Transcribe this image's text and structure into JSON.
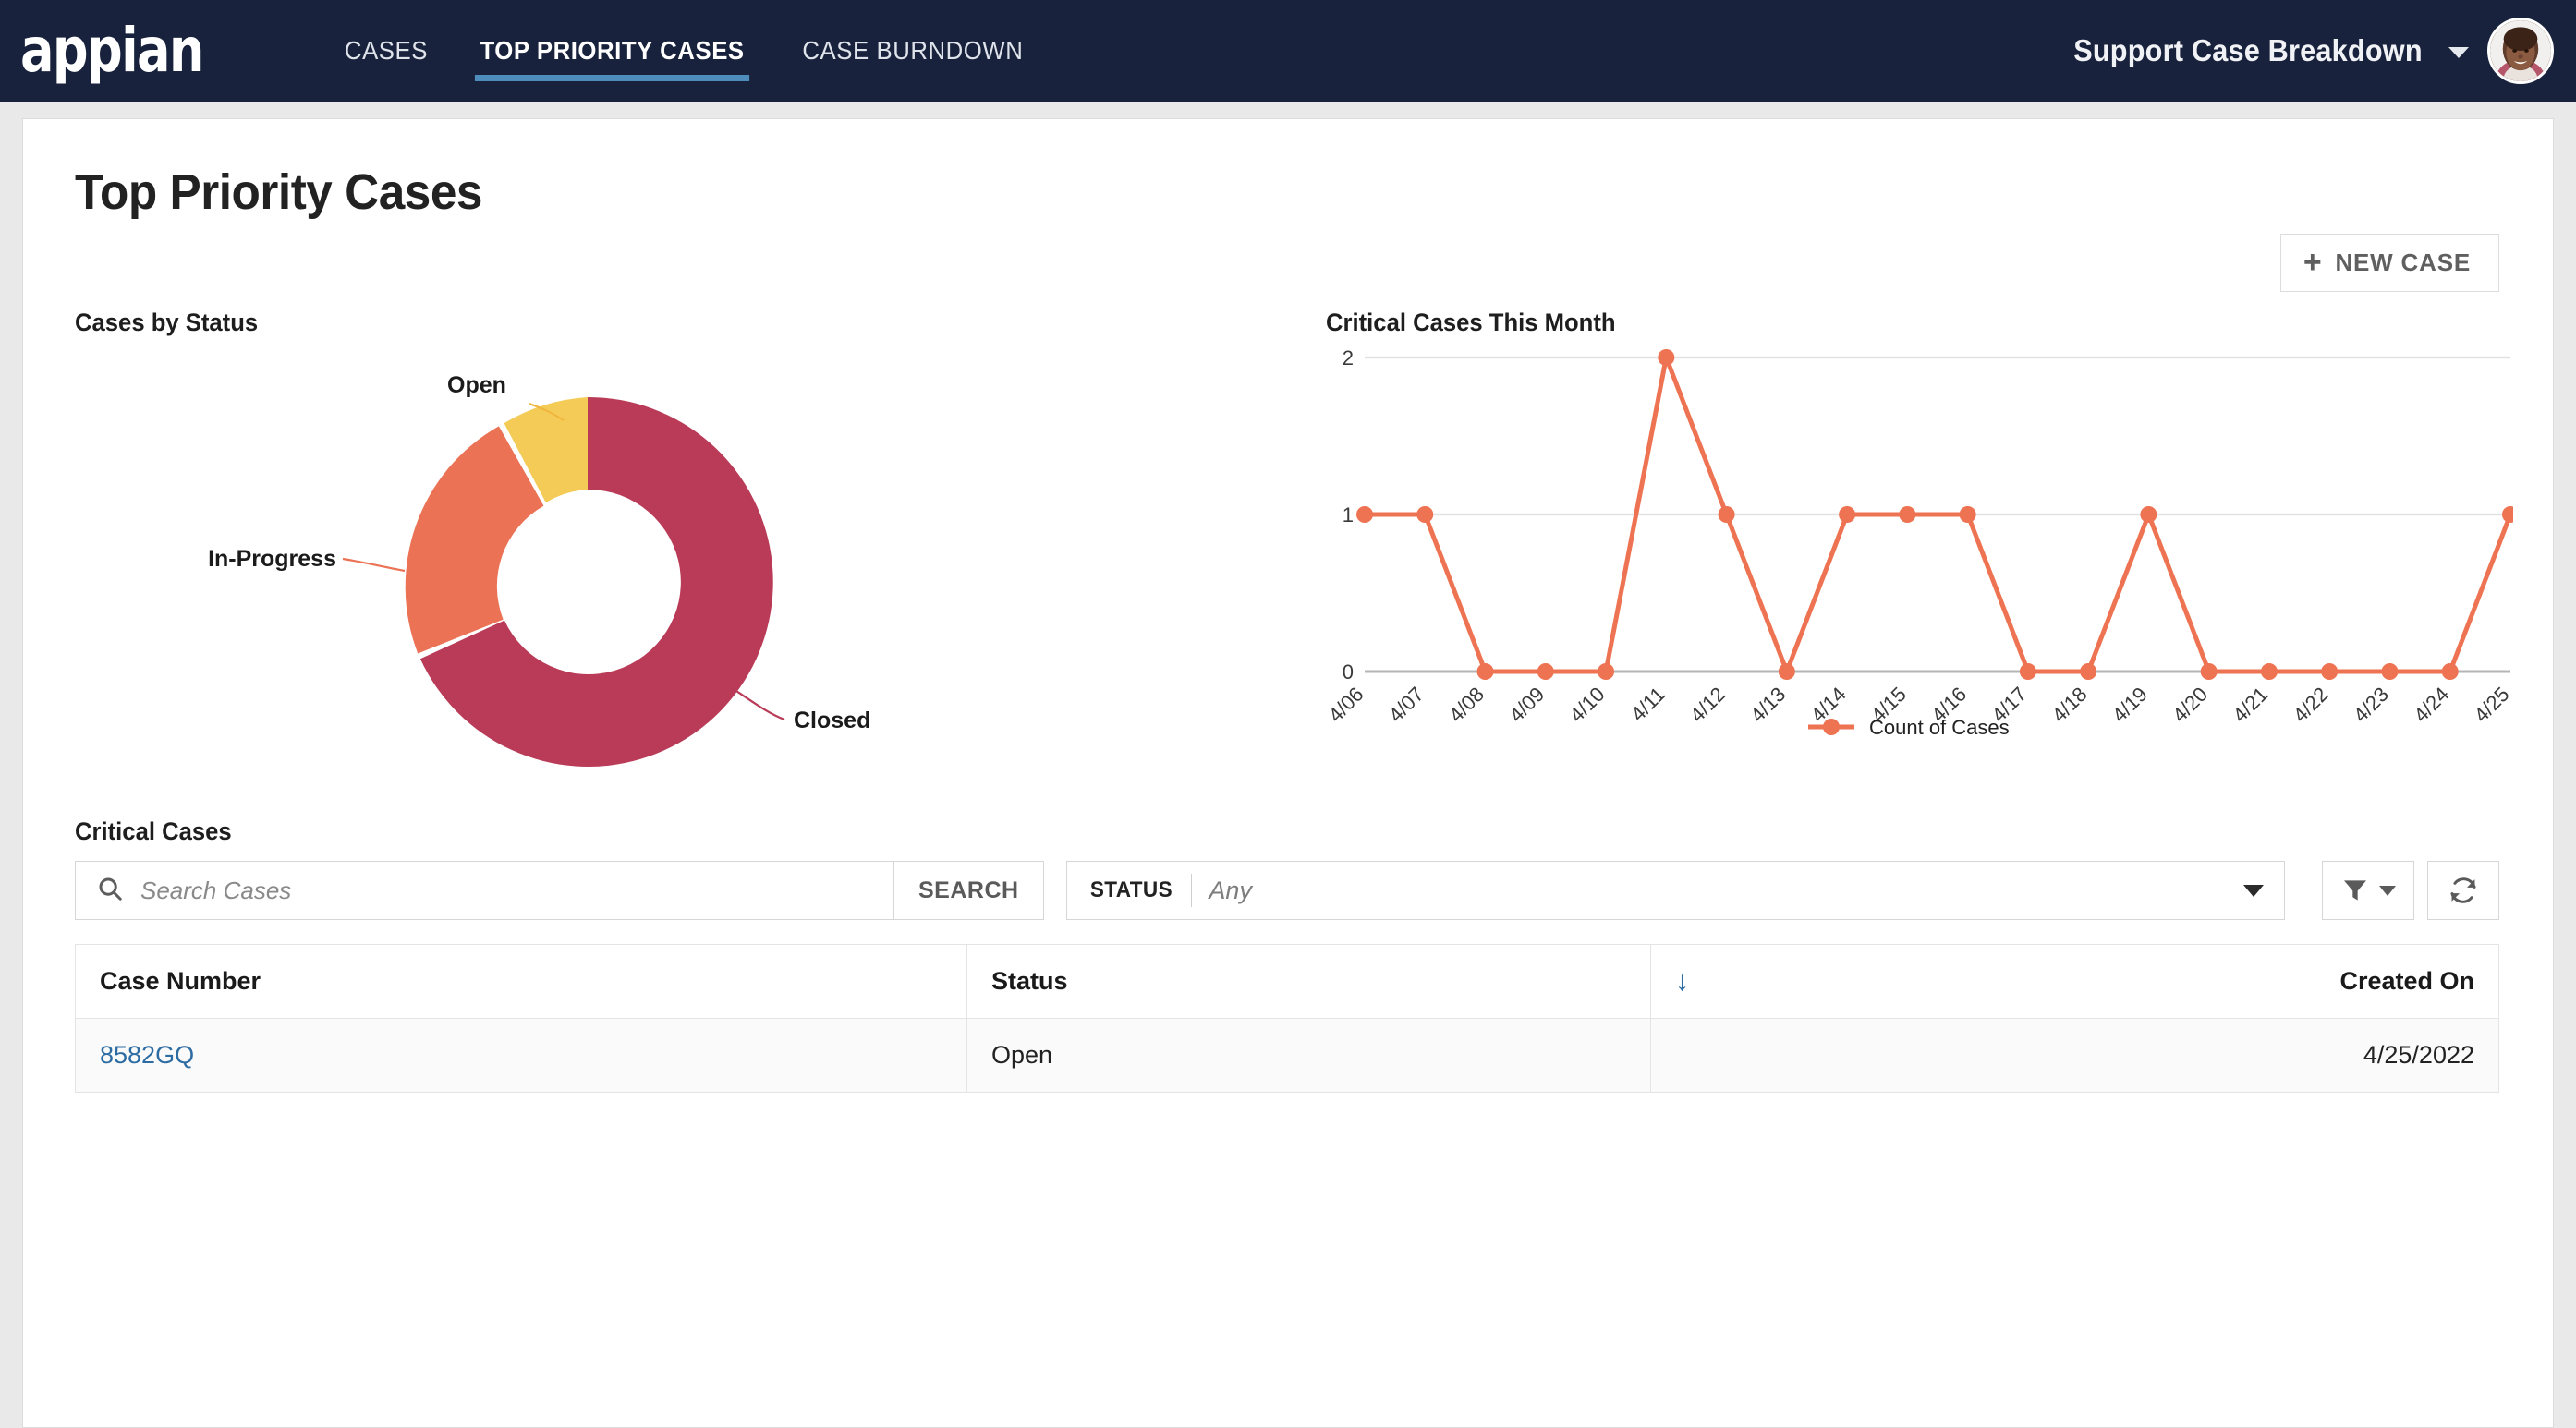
{
  "topbar": {
    "logo_text": "appian",
    "nav_items": [
      {
        "label": "CASES",
        "active": false
      },
      {
        "label": "TOP PRIORITY CASES",
        "active": true
      },
      {
        "label": "CASE BURNDOWN",
        "active": false
      }
    ],
    "app_title": "Support Case Breakdown",
    "avatar_alt": "user-avatar"
  },
  "page": {
    "title": "Top Priority Cases",
    "new_case_label": "NEW CASE",
    "new_case_plus": "+"
  },
  "donut": {
    "title": "Cases by Status",
    "labels": {
      "open": "Open",
      "in_progress": "In-Progress",
      "closed": "Closed"
    }
  },
  "line": {
    "title": "Critical Cases This Month",
    "legend": "Count of Cases"
  },
  "grid": {
    "title": "Critical Cases",
    "search_placeholder": "Search Cases",
    "search_value": "",
    "search_button": "SEARCH",
    "status_label": "STATUS",
    "status_value": "Any",
    "filter_icon": "filter-icon",
    "refresh_icon": "refresh-icon",
    "sort_arrow": "↓",
    "columns": [
      "Case Number",
      "Status",
      "",
      "Created On"
    ],
    "rows": [
      {
        "case_number": "8582GQ",
        "status": "Open",
        "created_on": "4/25/2022"
      }
    ]
  },
  "colors": {
    "nav_bg": "#18223c",
    "nav_active_underline": "#4e8dbb",
    "closed": "#b93b57",
    "in_progress": "#eb7254",
    "open": "#f3cb56",
    "line": "#ee7352",
    "link": "#2d6ca3",
    "sort_arrow": "#2e6da4"
  },
  "chart_data": [
    {
      "type": "pie",
      "title": "Cases by Status",
      "donut": true,
      "labels": [
        "Closed",
        "In-Progress",
        "Open"
      ],
      "values": [
        68,
        24,
        8
      ],
      "unit": "percent",
      "colors": [
        "#b93b57",
        "#eb7254",
        "#f3cb56"
      ],
      "legend_position": "callout-labels",
      "start_angle_deg": 0,
      "direction": "clockwise"
    },
    {
      "type": "line",
      "title": "Critical Cases This Month",
      "xlabel": "",
      "ylabel": "",
      "ylim": [
        0,
        2
      ],
      "yticks": [
        0,
        1,
        2
      ],
      "grid": true,
      "legend_position": "bottom",
      "marker": "circle",
      "color": "#ee7352",
      "categories": [
        "4/06",
        "4/07",
        "4/08",
        "4/09",
        "4/10",
        "4/11",
        "4/12",
        "4/13",
        "4/14",
        "4/15",
        "4/16",
        "4/17",
        "4/18",
        "4/19",
        "4/20",
        "4/21",
        "4/22",
        "4/23",
        "4/24",
        "4/25"
      ],
      "series": [
        {
          "name": "Count of Cases",
          "values": [
            1,
            1,
            0,
            0,
            0,
            2,
            1,
            0,
            1,
            1,
            1,
            0,
            0,
            1,
            0,
            0,
            0,
            0,
            0,
            1
          ]
        }
      ]
    }
  ]
}
